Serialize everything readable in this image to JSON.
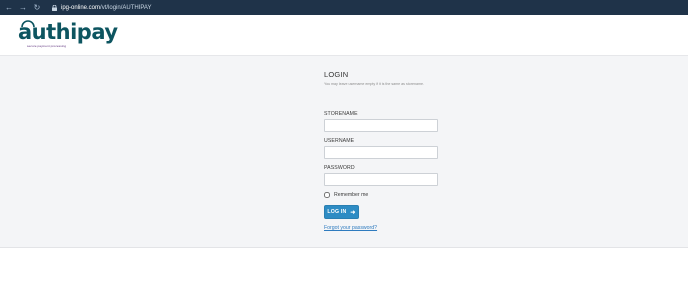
{
  "browser": {
    "url_host": "ipg-online.com",
    "url_path": "/vt/login/AUTHIPAY"
  },
  "logo": {
    "wordmark": "authipay",
    "tagline": "secure payment processing"
  },
  "login": {
    "title": "LOGIN",
    "hint": "You may leave username empty if it is the same as storename.",
    "storename_label": "STORENAME",
    "storename_value": "",
    "username_label": "USERNAME",
    "username_value": "",
    "password_label": "PASSWORD",
    "password_value": "",
    "remember_label": "Remember me",
    "remember_checked": false,
    "button_label": "LOG IN",
    "forgot_label": "Forgot your password?"
  },
  "colors": {
    "chrome": "#1f3349",
    "brand": "#0d5560",
    "button": "#2e8cc4",
    "link": "#2e7bbf",
    "band": "#f4f5f7"
  }
}
